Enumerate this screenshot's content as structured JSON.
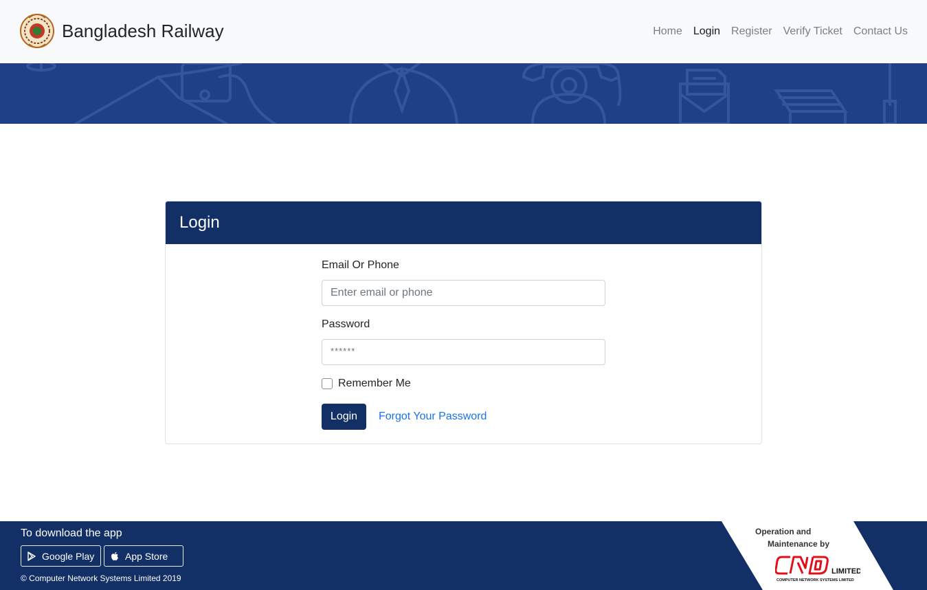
{
  "navbar": {
    "brand": "Bangladesh Railway",
    "logo_icon": "railway-emblem-icon",
    "links": [
      "Home",
      "Login",
      "Register",
      "Verify Ticket",
      "Contact Us"
    ],
    "active_link": "Login"
  },
  "login_card": {
    "title": "Login",
    "email_label": "Email Or Phone",
    "email_placeholder": "Enter email or phone",
    "email_value": "",
    "password_label": "Password",
    "password_placeholder": "******",
    "password_value": "",
    "remember_label": "Remember Me",
    "remember_checked": false,
    "submit_label": "Login",
    "forgot_label": "Forgot Your Password"
  },
  "footer": {
    "download_title": "To download the app",
    "google_play_label": "Google Play",
    "google_play_icon": "play-store-icon",
    "app_store_label": "App Store",
    "app_store_icon": "apple-icon",
    "copyright": "© Computer Network Systems Limited 2019",
    "operation_line1": "Operation and",
    "operation_line2": "Maintenance by",
    "partner_logo_text": "CNS",
    "partner_logo_suffix": "LIMITED",
    "partner_logo_subtext": "COMPUTER NETWORK SYSTEMS LIMITED"
  },
  "colors": {
    "primary": "#122f66",
    "banner": "#1f3f86",
    "link": "#1a73e8",
    "partner_red": "#e0101a"
  }
}
